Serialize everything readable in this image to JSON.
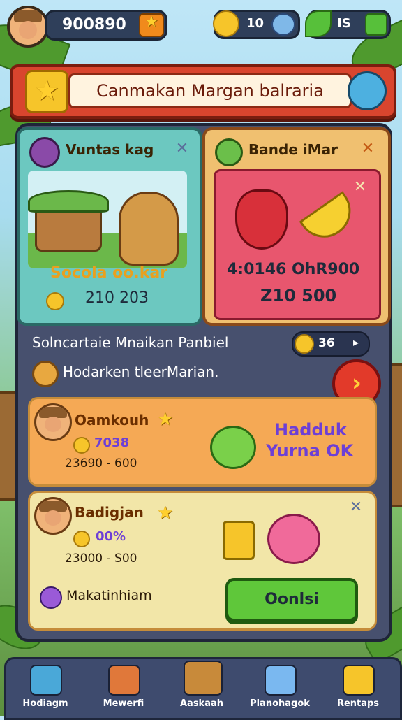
{
  "top_bar": {
    "score": "900890",
    "stat1": "10",
    "stat2": "IS"
  },
  "banner": {
    "title": "Canmakan Margan balraria"
  },
  "left_card": {
    "title": "Vuntas kag",
    "caption": "Socola oo.kar",
    "value": "210 203"
  },
  "right_card": {
    "title": "Bande iMar",
    "caption": "4:0146 OhR900",
    "value": "Z10 500"
  },
  "middle": {
    "heading": "Solncartaie Mnaikan Panbiel",
    "count": "36",
    "subheading": "Hodarken tleerMarian."
  },
  "entry1": {
    "name": "Oamkouh",
    "pct": "7038",
    "range": "23690 - 600",
    "promo_line1": "Hadduk",
    "promo_line2": "Yurna OK"
  },
  "entry2": {
    "name": "Badigjan",
    "pct": "00%",
    "range": "23000 - S00",
    "footer_label": "Makatinhiam",
    "confirm_label": "Oonlsi"
  },
  "nav": {
    "items": [
      "Hodiagm",
      "Mewerfi",
      "Aaskaah",
      "Planohagok",
      "Rentaps"
    ]
  },
  "colors": {
    "banner_red": "#d9452e",
    "confirm_green": "#5fc73a",
    "left_card_teal": "#6cc8c0",
    "right_card_pink": "#e8566e"
  }
}
